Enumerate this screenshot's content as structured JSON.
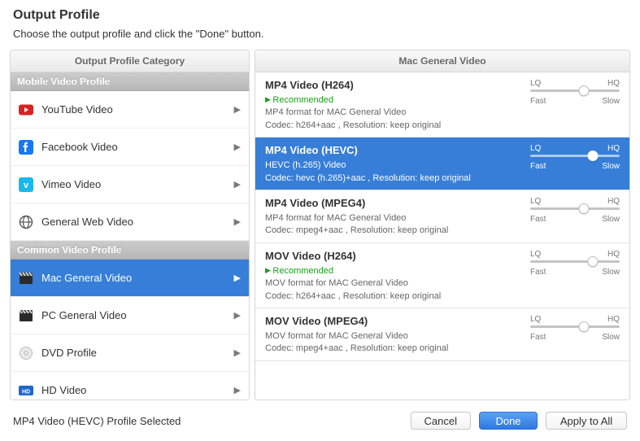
{
  "header": {
    "title": "Output Profile",
    "subtitle": "Choose the output profile and click the \"Done\" button."
  },
  "left": {
    "header": "Output Profile Category",
    "groups": [
      {
        "label": "Mobile Video Profile",
        "items": [
          {
            "label": "YouTube Video",
            "icon": "youtube"
          },
          {
            "label": "Facebook Video",
            "icon": "facebook"
          },
          {
            "label": "Vimeo Video",
            "icon": "vimeo"
          },
          {
            "label": "General Web Video",
            "icon": "globe"
          }
        ]
      },
      {
        "label": "Common Video Profile",
        "items": [
          {
            "label": "Mac General Video",
            "icon": "clap",
            "selected": true
          },
          {
            "label": "PC General Video",
            "icon": "clap"
          },
          {
            "label": "DVD Profile",
            "icon": "disc"
          },
          {
            "label": "HD Video",
            "icon": "hd"
          }
        ]
      }
    ]
  },
  "right": {
    "header": "Mac General Video",
    "q": {
      "lq": "LQ",
      "hq": "HQ",
      "fast": "Fast",
      "slow": "Slow"
    },
    "items": [
      {
        "title": "MP4 Video (H264)",
        "recommended": "Recommended",
        "line1": "MP4 format for MAC General Video",
        "line2": "Codec: h264+aac , Resolution: keep original",
        "pos": 60
      },
      {
        "title": "MP4 Video (HEVC)",
        "selected": true,
        "line1": "HEVC (h.265) Video",
        "line2": "Codec: hevc (h.265)+aac , Resolution: keep original",
        "pos": 70
      },
      {
        "title": "MP4 Video (MPEG4)",
        "line1": "MP4 format for MAC General Video",
        "line2": "Codec: mpeg4+aac , Resolution: keep original",
        "pos": 60
      },
      {
        "title": "MOV Video (H264)",
        "recommended": "Recommended",
        "line1": "MOV format for MAC General Video",
        "line2": "Codec: h264+aac , Resolution: keep original",
        "pos": 70
      },
      {
        "title": "MOV Video (MPEG4)",
        "line1": "MOV format for MAC General Video",
        "line2": "Codec: mpeg4+aac , Resolution: keep original",
        "pos": 60
      }
    ]
  },
  "footer": {
    "status": "MP4 Video (HEVC) Profile Selected",
    "cancel": "Cancel",
    "done": "Done",
    "apply": "Apply to All"
  }
}
